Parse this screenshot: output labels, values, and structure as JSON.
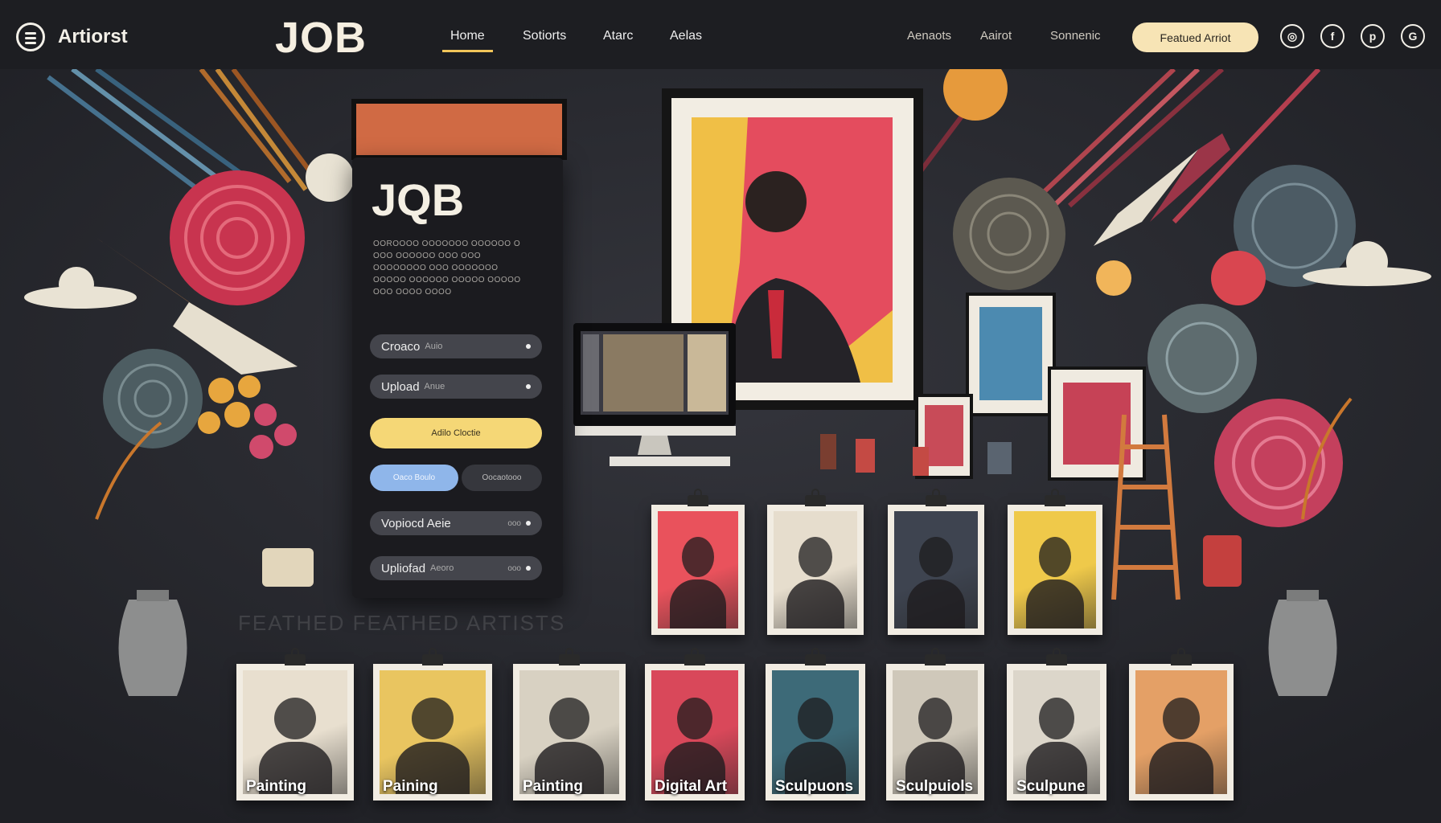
{
  "header": {
    "brand": "Artiorst",
    "logo": "JOB",
    "nav": [
      "Home",
      "Sotiorts",
      "Atarc",
      "Aelas"
    ],
    "nav_right": [
      "Aenaots",
      "Aairot",
      "Sonnenic"
    ],
    "cta": "Featued Arriot",
    "social_icons": [
      "instagram-icon",
      "facebook-icon",
      "pinterest-icon",
      "github-icon"
    ]
  },
  "panel": {
    "title": "JQB",
    "body_text": "OOROOOO OOOOOOO OOOOOO O OOO OOOOOO OOO OOO OOOOOOOO OOO OOOOOOO OOOOO OOOOOO OOOOO OOOOO OOO OOOO OOOO",
    "pills": [
      {
        "label": "Croaco",
        "sub": "Auio",
        "extra": ""
      },
      {
        "label": "Upload",
        "sub": "Anue",
        "extra": ""
      }
    ],
    "yellow_button": "Adilo Cloctie",
    "blue_button": "Oaco Boulo",
    "dark_button": "Oocaotooo",
    "pills_bottom": [
      {
        "label": "Vopiocd Aeie",
        "sub": "",
        "extra": "ooo"
      },
      {
        "label": "Upliofad",
        "sub": "Aeoro",
        "extra": "ooo"
      }
    ]
  },
  "featured_label": "FEATHED FEATHED ARTISTS",
  "gallery_top": [
    {
      "caption": "",
      "bg": "#e9525c"
    },
    {
      "caption": "",
      "bg": "#e6ddcd"
    },
    {
      "caption": "",
      "bg": "#3e4450"
    },
    {
      "caption": "",
      "bg": "#efc94a"
    }
  ],
  "gallery_bottom": [
    {
      "caption": "Painting",
      "bg": "#e8dfcf"
    },
    {
      "caption": "Paining",
      "bg": "#e9c560"
    },
    {
      "caption": "Painting",
      "bg": "#d8d1c2"
    },
    {
      "caption": "Digital Art",
      "bg": "#d9485a"
    },
    {
      "caption": "Sculpuons",
      "bg": "#3d6a78"
    },
    {
      "caption": "Sculpuiols",
      "bg": "#cfc8ba"
    },
    {
      "caption": "Sculpune",
      "bg": "#dcd6ca"
    },
    {
      "caption": "",
      "bg": "#e4a066"
    }
  ],
  "colors": {
    "background": "#2a2b31",
    "topbar": "#1d1e22",
    "accent_yellow": "#f5d776",
    "accent_red": "#e0465e",
    "accent_blue": "#8fb6ea",
    "cream": "#f1ece2"
  }
}
